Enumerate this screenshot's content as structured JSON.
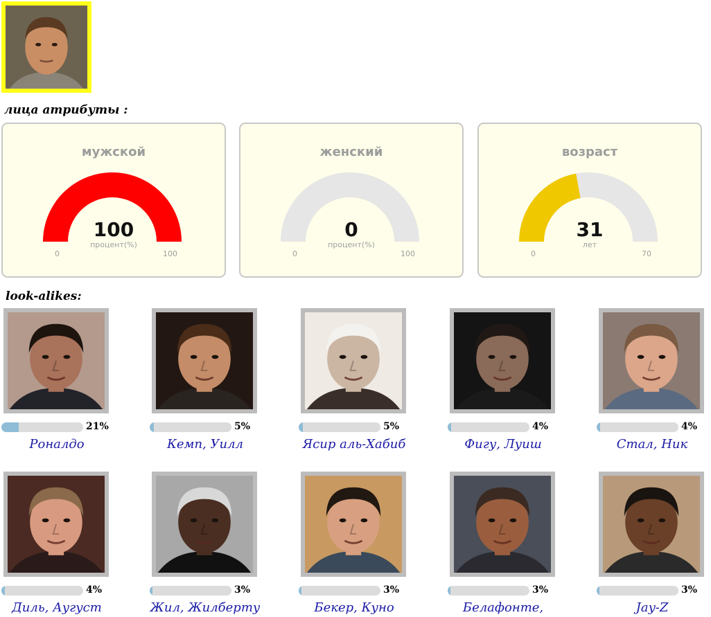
{
  "uploaded_photo": {
    "alt": "uploaded face",
    "border_color": "#ffff1a",
    "background": "#6b6350",
    "skin": "#c98e64",
    "hair": "#5a3a22",
    "shirt": "#8a8478"
  },
  "attributes_label": "лица атрибуты :",
  "gauges": [
    {
      "title": "мужской",
      "value": "100",
      "unit": "процент(%)",
      "min": "0",
      "max": "100",
      "fraction": 1.0,
      "color": "#ff0000"
    },
    {
      "title": "женский",
      "value": "0",
      "unit": "процент(%)",
      "min": "0",
      "max": "100",
      "fraction": 0.0,
      "color": "#ff0000"
    },
    {
      "title": "возраст",
      "value": "31",
      "unit": "лет",
      "min": "0",
      "max": "70",
      "fraction": 0.443,
      "color": "#f0c800"
    }
  ],
  "gauge_track_color": "#e6e6e6",
  "lookalikes_label": "look-alikes:",
  "lookalikes": [
    {
      "name": "Роналдо",
      "percent": "21%",
      "fraction": 0.21,
      "bg": "#b39a8c",
      "skin": "#a9725a",
      "hair": "#1e140e",
      "shirt": "#23232a"
    },
    {
      "name": "Кемп, Уилл",
      "percent": "5%",
      "fraction": 0.05,
      "bg": "#221712",
      "skin": "#c48c68",
      "hair": "#4a2c18",
      "shirt": "#2a2420"
    },
    {
      "name": "Ясир аль-Хабиб",
      "percent": "5%",
      "fraction": 0.05,
      "bg": "#efeae4",
      "skin": "#cbb6a4",
      "hair": "#f4f2ee",
      "shirt": "#3a2e2a"
    },
    {
      "name": "Фигу, Луиш",
      "percent": "4%",
      "fraction": 0.04,
      "bg": "#141414",
      "skin": "#8a6a58",
      "hair": "#201814",
      "shirt": "#1a1a1a"
    },
    {
      "name": "Стал, Ник",
      "percent": "4%",
      "fraction": 0.04,
      "bg": "#8a7a72",
      "skin": "#dca68a",
      "hair": "#7a5a42",
      "shirt": "#5a6a80"
    },
    {
      "name": "Диль, Аугуст",
      "percent": "4%",
      "fraction": 0.04,
      "bg": "#4a2a22",
      "skin": "#d89a80",
      "hair": "#8a6a4a",
      "shirt": "#2a1a1a"
    },
    {
      "name": "Жил, Жилберту",
      "percent": "3%",
      "fraction": 0.03,
      "bg": "#a8a8a8",
      "skin": "#4a2e22",
      "hair": "#d8d8d8",
      "shirt": "#111111"
    },
    {
      "name": "Бекер, Куно",
      "percent": "3%",
      "fraction": 0.03,
      "bg": "#c89a62",
      "skin": "#d8a080",
      "hair": "#221812",
      "shirt": "#3a4a5a"
    },
    {
      "name": "Белафонте,",
      "percent": "3%",
      "fraction": 0.03,
      "bg": "#4a4e58",
      "skin": "#9a5e3e",
      "hair": "#3a2a22",
      "shirt": "#2a2a30"
    },
    {
      "name": "Jay-Z",
      "percent": "3%",
      "fraction": 0.03,
      "bg": "#b89a7a",
      "skin": "#6a4028",
      "hair": "#1a1410",
      "shirt": "#2a2a2a"
    }
  ],
  "bar_fill_color": "#8fbcd6",
  "bar_track_color": "#dcdcdc"
}
